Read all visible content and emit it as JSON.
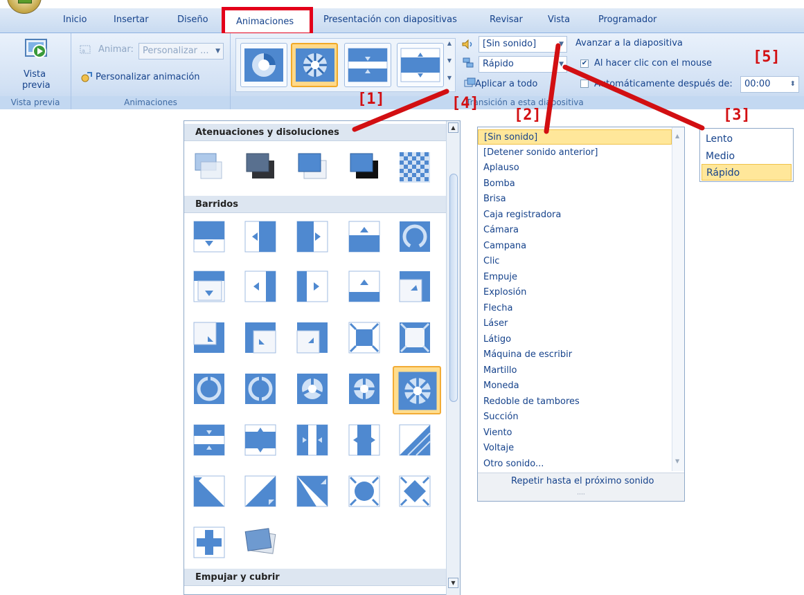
{
  "ribbon": {
    "tabs": [
      "Inicio",
      "Insertar",
      "Diseño",
      "Animaciones",
      "Presentación con diapositivas",
      "Revisar",
      "Vista",
      "Programador"
    ],
    "active_tab": "Animaciones",
    "preview": {
      "label_line1": "Vista",
      "label_line2": "previa",
      "group": "Vista previa"
    },
    "animations": {
      "animar_label": "Animar:",
      "animar_value": "Personalizar ...",
      "custom_label": "Personalizar animación",
      "group": "Animaciones"
    },
    "transition": {
      "sound_value": "[Sin sonido]",
      "speed_value": "Rápido",
      "apply_all_label": "Aplicar a todo",
      "group": "Transición a esta diapositiva",
      "advance_title": "Avanzar a la diapositiva",
      "on_click_label": "Al hacer clic con el mouse",
      "on_click_checked": true,
      "auto_label": "Automáticamente después de:",
      "auto_time": "00:00"
    }
  },
  "gallery": {
    "sections": [
      "Atenuaciones y disoluciones",
      "Barridos",
      "Empujar y cubrir"
    ]
  },
  "sound_list": {
    "items": [
      "[Sin sonido]",
      "[Detener sonido anterior]",
      "Aplauso",
      "Bomba",
      "Brisa",
      "Caja registradora",
      "Cámara",
      "Campana",
      "Clic",
      "Empuje",
      "Explosión",
      "Flecha",
      "Láser",
      "Látigo",
      "Máquina de escribir",
      "Martillo",
      "Moneda",
      "Redoble de tambores",
      "Succión",
      "Viento",
      "Voltaje",
      "Otro sonido..."
    ],
    "selected": "[Sin sonido]",
    "loop_label": "Repetir hasta el próximo sonido"
  },
  "speed_list": {
    "items": [
      "Lento",
      "Medio",
      "Rápido"
    ],
    "selected": "Rápido"
  },
  "annotations": [
    "[1]",
    "[2]",
    "[3]",
    "[4]",
    "[5]"
  ],
  "colors": {
    "annotation_red": "#d20f12",
    "ribbon_blue": "#15428b",
    "highlight": "#ffe79a"
  }
}
